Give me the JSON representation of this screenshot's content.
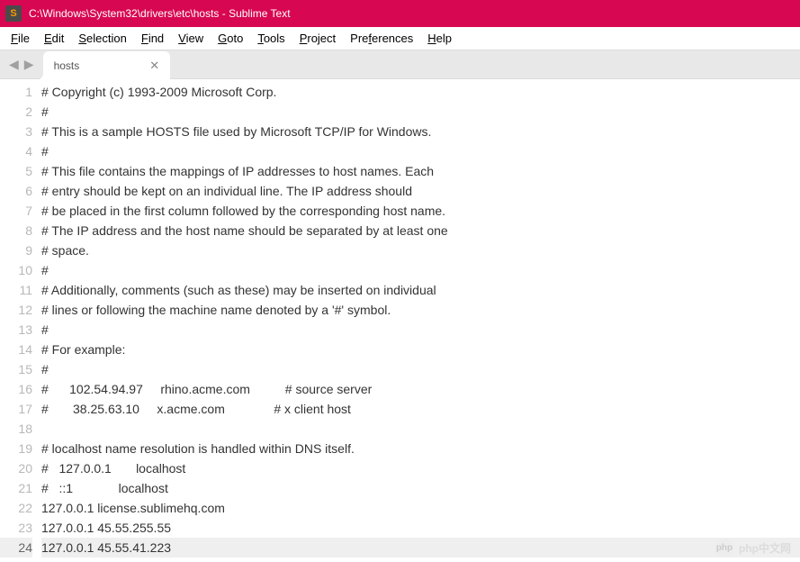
{
  "window": {
    "title": "C:\\Windows\\System32\\drivers\\etc\\hosts - Sublime Text"
  },
  "menu": {
    "items": [
      {
        "label": "File",
        "hotkey_index": 0
      },
      {
        "label": "Edit",
        "hotkey_index": 0
      },
      {
        "label": "Selection",
        "hotkey_index": 0
      },
      {
        "label": "Find",
        "hotkey_index": 0
      },
      {
        "label": "View",
        "hotkey_index": 0
      },
      {
        "label": "Goto",
        "hotkey_index": 0
      },
      {
        "label": "Tools",
        "hotkey_index": 0
      },
      {
        "label": "Project",
        "hotkey_index": 0
      },
      {
        "label": "Preferences",
        "hotkey_index": 3
      },
      {
        "label": "Help",
        "hotkey_index": 0
      }
    ]
  },
  "tabs": {
    "active": {
      "label": "hosts"
    }
  },
  "editor": {
    "current_line_index": 23,
    "lines": [
      "# Copyright (c) 1993-2009 Microsoft Corp.",
      "#",
      "# This is a sample HOSTS file used by Microsoft TCP/IP for Windows.",
      "#",
      "# This file contains the mappings of IP addresses to host names. Each",
      "# entry should be kept on an individual line. The IP address should",
      "# be placed in the first column followed by the corresponding host name.",
      "# The IP address and the host name should be separated by at least one",
      "# space.",
      "#",
      "# Additionally, comments (such as these) may be inserted on individual",
      "# lines or following the machine name denoted by a '#' symbol.",
      "#",
      "# For example:",
      "#",
      "#      102.54.94.97     rhino.acme.com          # source server",
      "#       38.25.63.10     x.acme.com              # x client host",
      "",
      "# localhost name resolution is handled within DNS itself.",
      "#   127.0.0.1       localhost",
      "#   ::1             localhost",
      "127.0.0.1 license.sublimehq.com",
      "127.0.0.1 45.55.255.55",
      "127.0.0.1 45.55.41.223"
    ]
  },
  "watermark": {
    "icon_text": "php",
    "label": "php中文网"
  }
}
